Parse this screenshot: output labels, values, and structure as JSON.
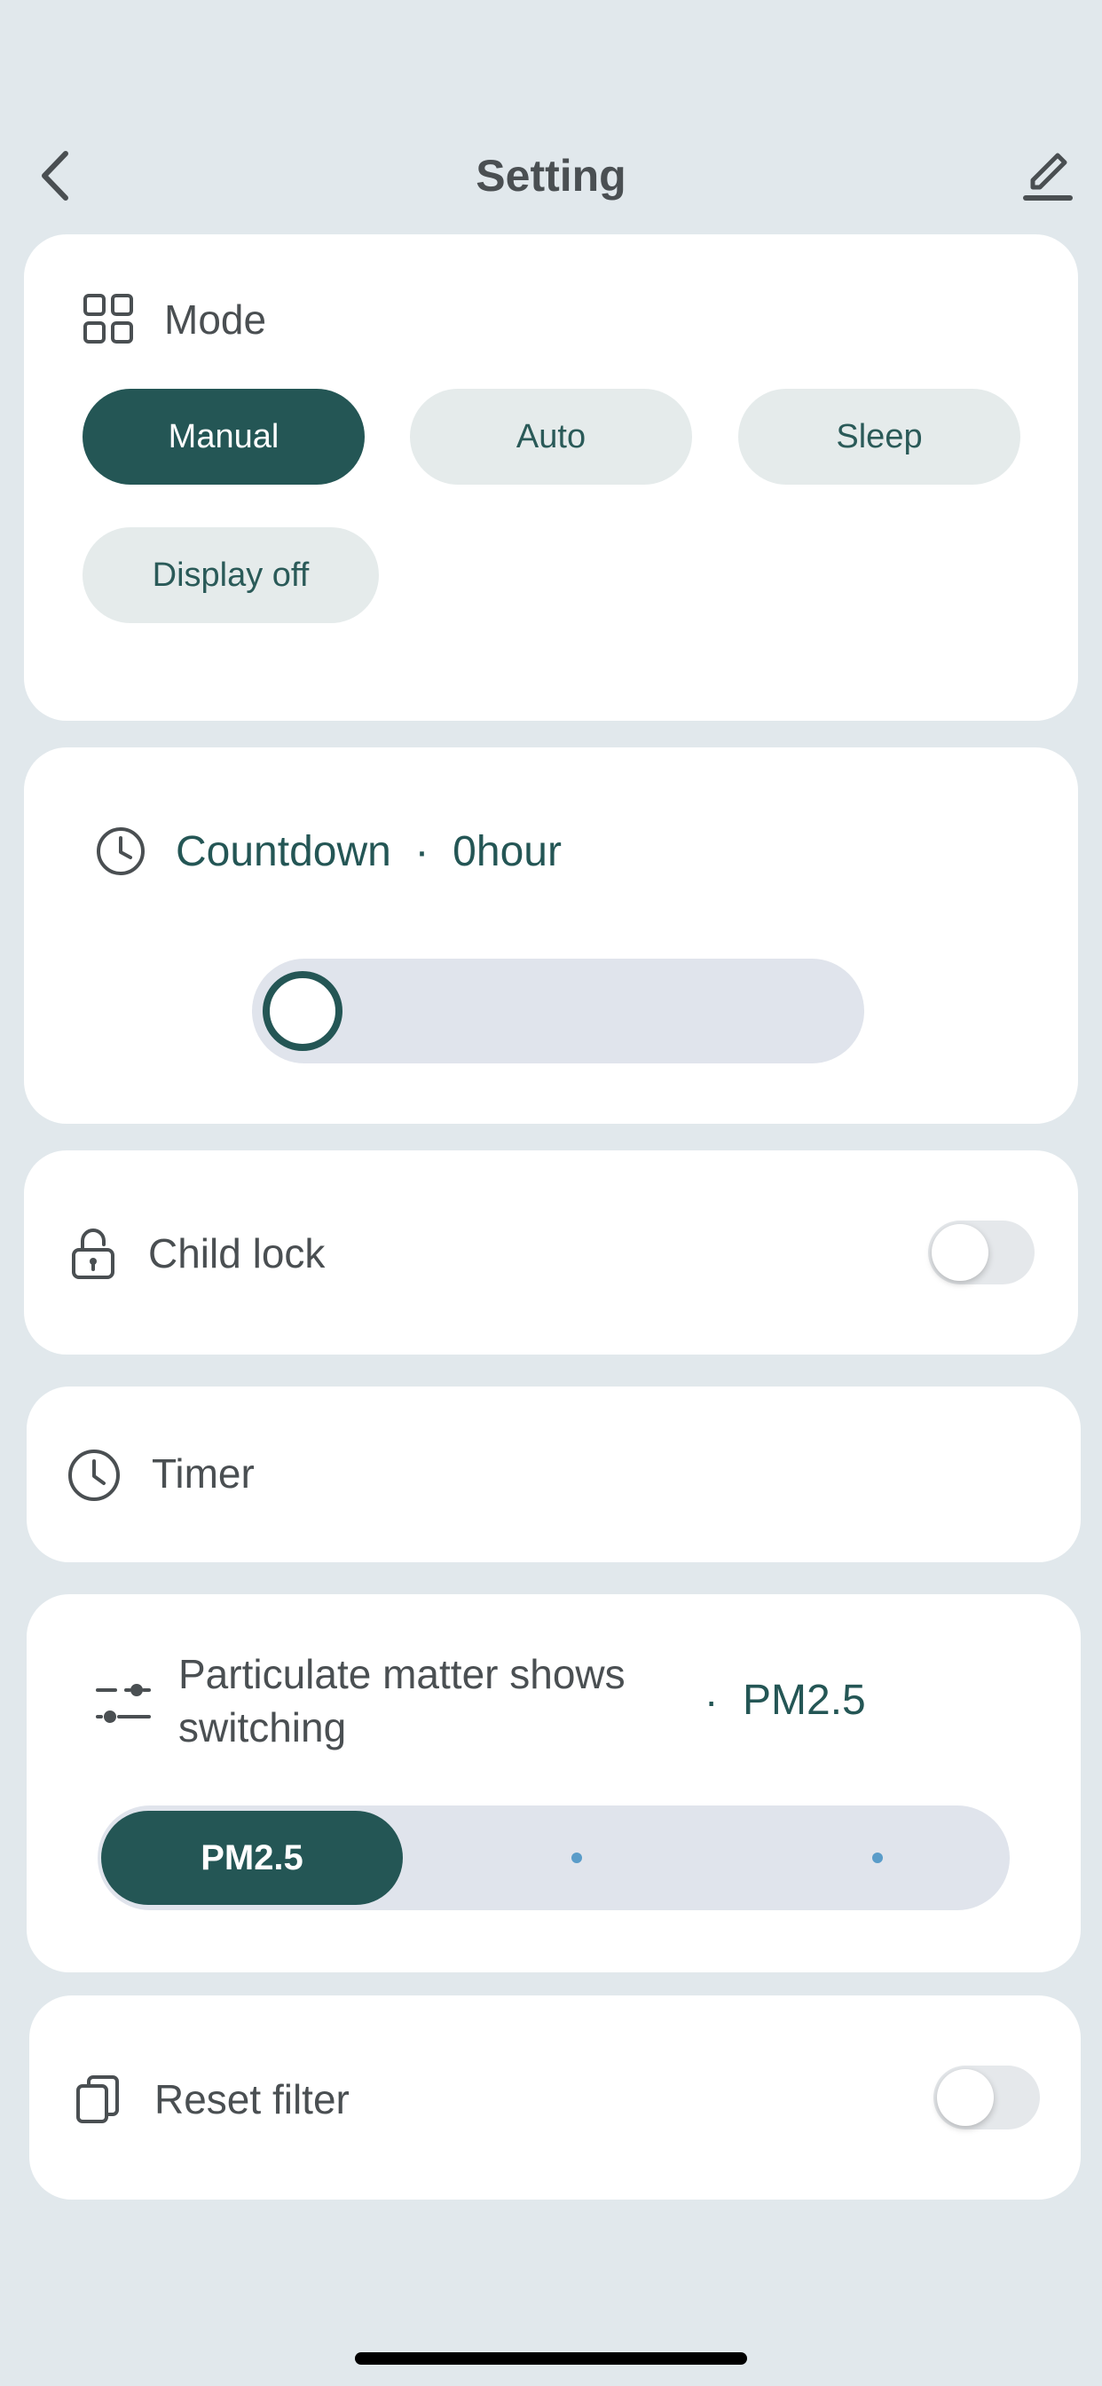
{
  "header": {
    "title": "Setting",
    "back_icon": "chevron-left-icon",
    "edit_icon": "pencil-icon"
  },
  "mode": {
    "label": "Mode",
    "icon": "grid-icon",
    "options": [
      "Manual",
      "Auto",
      "Sleep",
      "Display off"
    ],
    "selected": "Manual"
  },
  "countdown": {
    "label": "Countdown",
    "separator": "·",
    "value": "0hour",
    "icon": "clock-icon",
    "slider_level": 0
  },
  "child_lock": {
    "label": "Child lock",
    "icon": "lock-icon",
    "enabled": false
  },
  "timer": {
    "label": "Timer",
    "icon": "clock-icon"
  },
  "particulate": {
    "label": "Particulate matter shows switching",
    "separator": "·",
    "value": "PM2.5",
    "icon": "sliders-icon",
    "active_option": "PM2.5"
  },
  "reset_filter": {
    "label": "Reset filter",
    "icon": "copy-icon",
    "enabled": false
  },
  "colors": {
    "accent": "#245655",
    "background": "#e1e8ec",
    "card": "#ffffff",
    "pill_inactive": "#e5ebeb",
    "option_dot": "#5a9cc9"
  }
}
